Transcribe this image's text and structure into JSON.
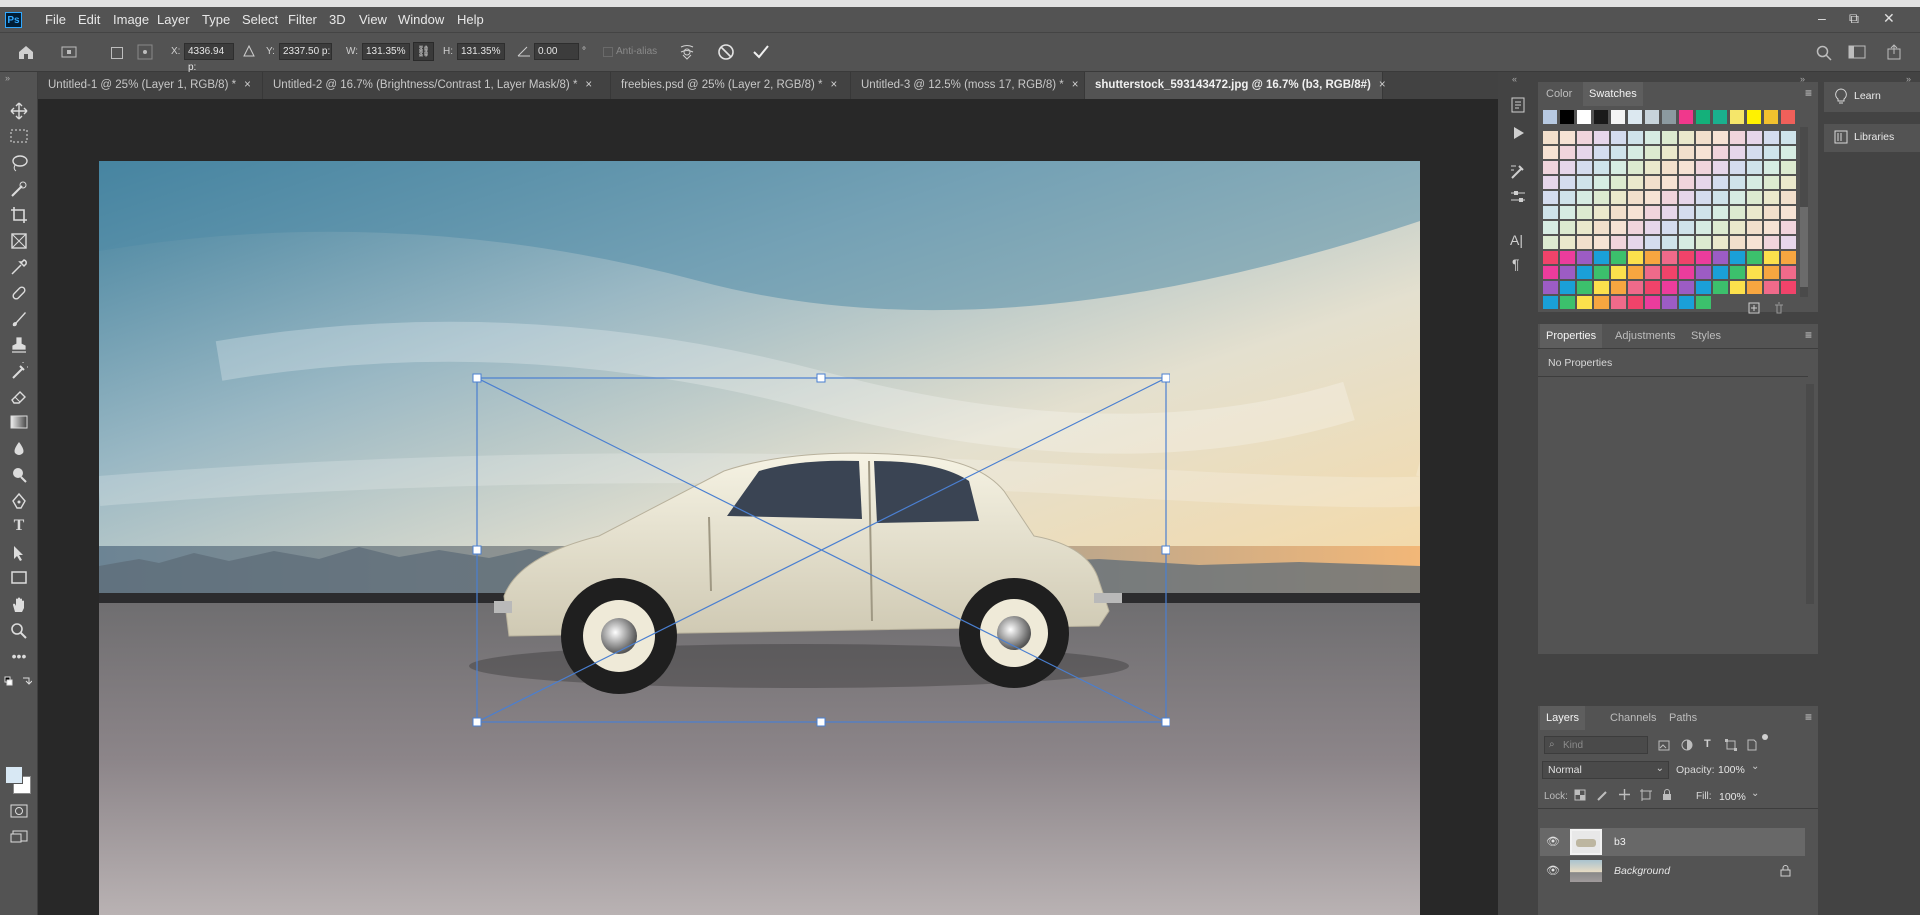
{
  "app": {
    "logo": "Ps"
  },
  "menu": [
    "File",
    "Edit",
    "Image",
    "Layer",
    "Type",
    "Select",
    "Filter",
    "3D",
    "View",
    "Window",
    "Help"
  ],
  "window_controls": {
    "minimize": "–",
    "restore": "⧉",
    "close": "✕"
  },
  "options": {
    "x_label": "X:",
    "x_value": "4336.94 p:",
    "y_label": "Y:",
    "y_value": "2337.50 p:",
    "w_label": "W:",
    "w_value": "131.35%",
    "h_label": "H:",
    "h_value": "131.35%",
    "angle_value": "0.00",
    "angle_unit": "°",
    "antialias": "Anti-alias"
  },
  "tabs": [
    {
      "label": "Untitled-1 @ 25% (Layer 1, RGB/8) *"
    },
    {
      "label": "Untitled-2 @ 16.7% (Brightness/Contrast 1, Layer Mask/8) *"
    },
    {
      "label": "freebies.psd @ 25% (Layer 2, RGB/8) *"
    },
    {
      "label": "Untitled-3 @ 12.5% (moss 17, RGB/8) *"
    },
    {
      "label": "shutterstock_593143472.jpg @ 16.7% (b3, RGB/8#)"
    }
  ],
  "tab_close": "×",
  "swatches_panel": {
    "tabs": [
      "Color",
      "Swatches"
    ],
    "active": "Swatches"
  },
  "properties_panel": {
    "tabs": [
      "Properties",
      "Adjustments",
      "Styles"
    ],
    "empty_text": "No Properties"
  },
  "layers_panel": {
    "tabs": [
      "Layers",
      "Channels",
      "Paths"
    ],
    "kind_placeholder": "Kind",
    "blend_mode": "Normal",
    "opacity_label": "Opacity:",
    "opacity_value": "100%",
    "lock_label": "Lock:",
    "fill_label": "Fill:",
    "fill_value": "100%",
    "layers": [
      {
        "name": "b3"
      },
      {
        "name": "Background"
      }
    ]
  },
  "learn_panel": {
    "learn": "Learn",
    "libraries": "Libraries"
  },
  "colors": {
    "accent": "#4a7fd1",
    "swatch_top": [
      "#b7c9e1",
      "#000000",
      "#ffffff",
      "#1a1a1a",
      "#f4f4f4",
      "#dce8f0",
      "#c7d3da",
      "#8c9aa0",
      "#f0388c",
      "#14b07a",
      "#1ab08e",
      "#f5e66a",
      "#fff200",
      "#f2c12e",
      "#f0605a"
    ]
  }
}
